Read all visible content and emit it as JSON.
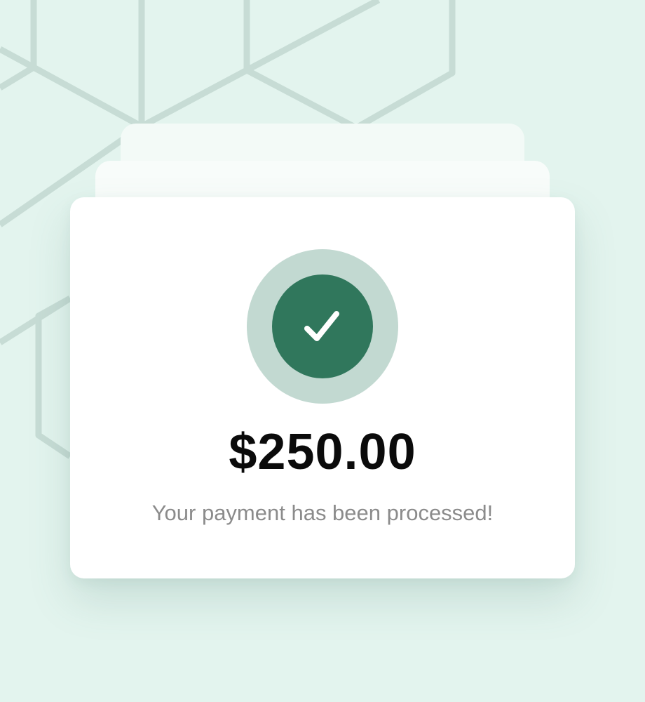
{
  "payment": {
    "amount": "$250.00",
    "message": "Your payment has been processed!",
    "status": "success",
    "status_icon": "check-icon"
  },
  "colors": {
    "background": "#e3f4ee",
    "pattern_line": "#c7dcd5",
    "accent": "#30775c",
    "accent_ring": "#c2d9d1",
    "card": "#ffffff",
    "amount_text": "#0b0b0b",
    "message_text": "#8b8b8b"
  }
}
